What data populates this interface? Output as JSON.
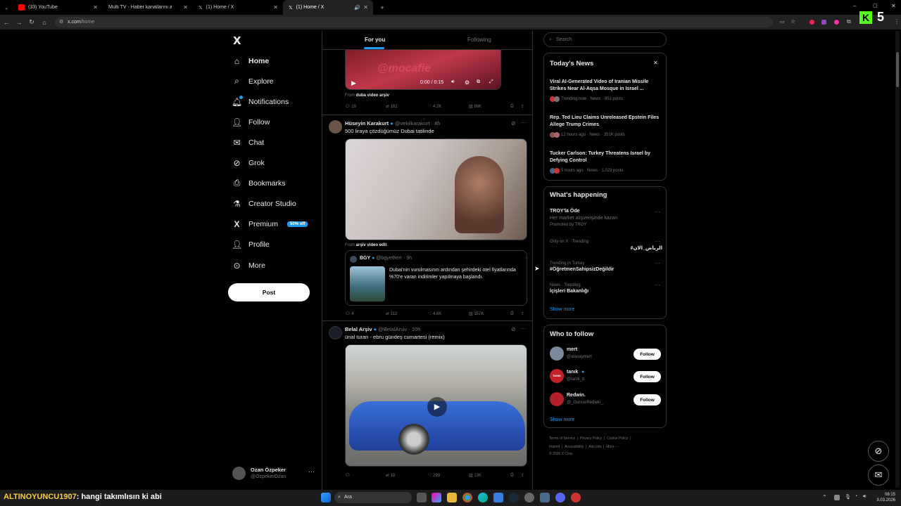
{
  "browser": {
    "tabs": [
      {
        "title": "(33) YouTube"
      },
      {
        "title": "Multi TV - Haber kanallarını ay"
      },
      {
        "title": "(1) Home / X"
      },
      {
        "title": "(1) Home / X"
      }
    ],
    "url_domain": "x.com",
    "url_path": "/home",
    "kick_number": "5"
  },
  "nav": {
    "logo": "X",
    "items": [
      {
        "label": "Home",
        "icon": "home-icon"
      },
      {
        "label": "Explore",
        "icon": "search-icon"
      },
      {
        "label": "Notifications",
        "icon": "bell-icon"
      },
      {
        "label": "Follow",
        "icon": "person-add-icon"
      },
      {
        "label": "Chat",
        "icon": "mail-icon"
      },
      {
        "label": "Grok",
        "icon": "grok-icon"
      },
      {
        "label": "Bookmarks",
        "icon": "bookmark-icon"
      },
      {
        "label": "Creator Studio",
        "icon": "flask-icon"
      },
      {
        "label": "Premium",
        "icon": "x-icon"
      },
      {
        "label": "Profile",
        "icon": "person-icon"
      },
      {
        "label": "More",
        "icon": "more-circle-icon"
      }
    ],
    "premium_badge": "50% off",
    "post_label": "Post",
    "profile_name": "Ozan Özpeker",
    "profile_handle": "@OzpekerOzan",
    "profile_more": "···"
  },
  "feed": {
    "tabs": {
      "for_you": "For you",
      "following": "Following"
    },
    "tweet0": {
      "watermark": "@mocafie",
      "video_time": "0:00 / 0:15",
      "from_prefix": "From",
      "from_source": "duba video arşiv",
      "replies": "19",
      "reposts": "182",
      "likes": "4.2K",
      "views": "86K"
    },
    "tweet1": {
      "name": "Hüseyin Karakurt",
      "handle": "@vekilkarakurt",
      "time": "· 8h",
      "text": "500 liraya çözdüğümüz Dubai tatilinde",
      "from_prefix": "From",
      "from_source": "arşiv video edit",
      "quote": {
        "name": "BGY",
        "handle": "@bgyetherr",
        "time": "· 9h",
        "text": "Dubai'nin vurulmasının ardından şehirdeki otel fiyatlarında %70'e varan indirimler yapılmaya başlandı."
      },
      "replies": "4",
      "reposts": "112",
      "likes": "4.6K",
      "views": "157K"
    },
    "tweet2": {
      "name": "Belal Arşiv",
      "handle": "@BelalArsiv",
      "time": "· 10h",
      "text": "ünal turan - ebru gündeş cumartesi (remix)",
      "replies": "",
      "reposts": "10",
      "likes": "299",
      "views": "13K"
    },
    "more_glyph": "···"
  },
  "right": {
    "search_placeholder": "Search",
    "todays_news": {
      "title": "Today's News",
      "items": [
        {
          "headline": "Viral AI-Generated Video of Iranian Missile Strikes Near Al-Aqsa Mosque in Israel ...",
          "meta": "Trending now · News · 951 posts"
        },
        {
          "headline": "Rep. Ted Lieu Claims Unreleased Epstein Files Allege Trump Crimes",
          "meta": "12 hours ago · News · 351K posts"
        },
        {
          "headline": "Tucker Carlson: Turkey Threatens Israel by Defying Control",
          "meta": "5 hours ago · News · 1,023 posts"
        }
      ]
    },
    "whats_happening": {
      "title": "What's happening",
      "promo": {
        "title": "TROY'la Öde",
        "desc": "Her market alışverişinde kazan",
        "promoted": "Promoted by TROY"
      },
      "trends": [
        {
          "context": "Only on X · Trending",
          "name": "#الرياض_الان"
        },
        {
          "context": "Trending in Turkey",
          "name": "#ÖğretmenSahipsizDeğildir"
        },
        {
          "context": "News · Trending",
          "name": "İçişleri Bakanlığı"
        }
      ],
      "show_more": "Show more"
    },
    "who_to_follow": {
      "title": "Who to follow",
      "users": [
        {
          "name": "mert",
          "handle": "@atasaymert"
        },
        {
          "name": "tanık",
          "handle": "@tanik_tr",
          "avatar_text": "TANIK"
        },
        {
          "name": "Redwin.",
          "handle": "@_GunceiRedwin_"
        }
      ],
      "follow_label": "Follow",
      "show_more": "Show more"
    },
    "footer": {
      "line1": [
        "Terms of Service",
        "|",
        "Privacy Policy",
        "|",
        "Cookie Policy",
        "|"
      ],
      "line2": [
        "Imprint",
        "|",
        "Accessibility",
        "|",
        "Ads info",
        "|",
        "More ···"
      ],
      "copyright": "© 2026 X Corp."
    }
  },
  "taskbar": {
    "overlay_user": "ALTINOYUNCU1907",
    "overlay_msg": ": hangi takımlısın ki abi",
    "search_label": "Ara",
    "time": "08:15",
    "date": "3.03.2026"
  },
  "colors": {
    "accent": "#1d9bf0",
    "border": "#2f3336",
    "muted": "#71767b"
  }
}
